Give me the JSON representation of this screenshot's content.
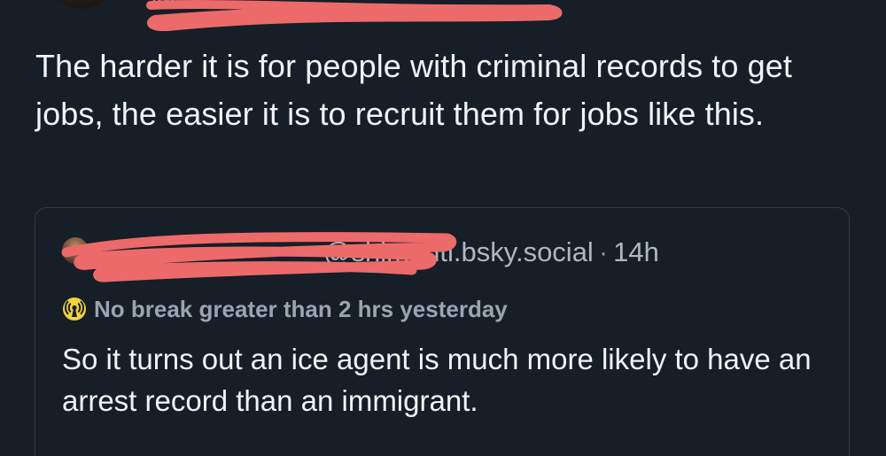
{
  "post": {
    "text": "The harder it is for people with criminal records to get jobs, the easier it is to recruit them for jobs like this."
  },
  "quote": {
    "handle": "@shimanti.bsky.social",
    "separator": "·",
    "time": "14h",
    "label": "No break greater than 2 hrs yesterday",
    "label_icon": "broadcast-icon",
    "text": "So it turns out an ice agent is much more likely to have an arrest record than an immigrant."
  },
  "colors": {
    "background": "#161e27",
    "text_primary": "#f1f3f5",
    "text_secondary": "#aeb8c2",
    "border": "#2e3a47",
    "redaction": "#ec6a6a",
    "label_icon_yellow": "#f2d23c"
  }
}
